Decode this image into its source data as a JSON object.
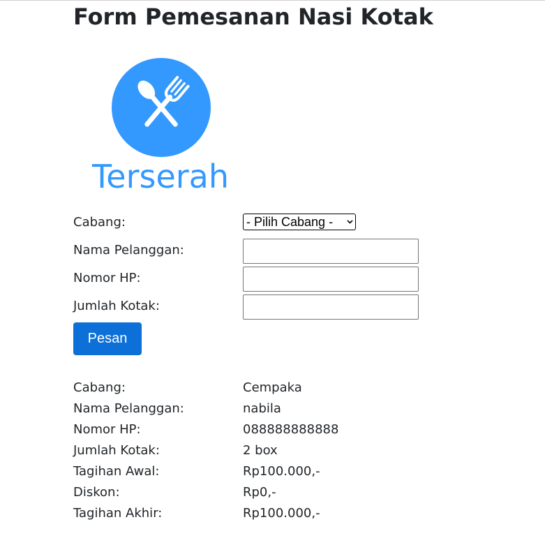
{
  "page": {
    "title": "Form Pemesanan Nasi Kotak"
  },
  "logo": {
    "icon": "fork-spoon-icon",
    "text": "Terserah",
    "color": "#3399ff"
  },
  "form": {
    "cabang_label": "Cabang:",
    "cabang_select": "- Pilih Cabang -",
    "nama_label": "Nama Pelanggan:",
    "nama_value": "",
    "hp_label": "Nomor HP:",
    "hp_value": "",
    "jumlah_label": "Jumlah Kotak:",
    "jumlah_value": "",
    "submit_label": "Pesan"
  },
  "result": [
    {
      "label": "Cabang:",
      "value": "Cempaka"
    },
    {
      "label": "Nama Pelanggan:",
      "value": "nabila"
    },
    {
      "label": "Nomor HP:",
      "value": "088888888888"
    },
    {
      "label": "Jumlah Kotak:",
      "value": "2 box"
    },
    {
      "label": "Tagihan Awal:",
      "value": "Rp100.000,-"
    },
    {
      "label": "Diskon:",
      "value": "Rp0,-"
    },
    {
      "label": "Tagihan Akhir:",
      "value": "Rp100.000,-"
    }
  ],
  "colors": {
    "button": "#0d6fd8",
    "logo": "#3399ff"
  }
}
